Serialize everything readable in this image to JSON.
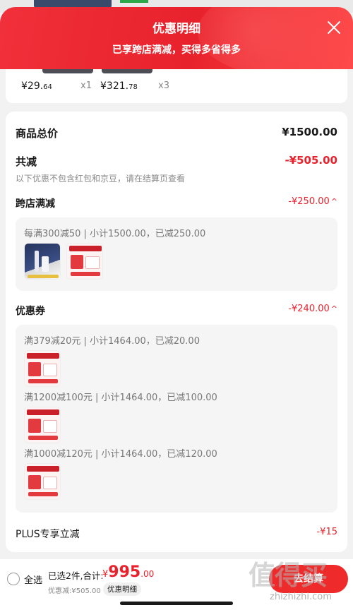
{
  "header": {
    "title": "优惠明细",
    "subtitle": "已享跨店满减，买得多省得多"
  },
  "products": [
    {
      "price_main": "¥29.",
      "price_dec": "64",
      "qty": "x1"
    },
    {
      "price_main": "¥321.",
      "price_dec": "78",
      "qty": "x3"
    }
  ],
  "summary": {
    "total_label": "商品总价",
    "total_value": "¥1500.00",
    "discount_label": "共减",
    "discount_value": "-¥505.00",
    "note": "以下优惠不包含红包和京豆，请在结算页查看"
  },
  "cross_store": {
    "label": "跨店满减",
    "value": "-¥250.00",
    "rule": "每满300减50 | 小计1500.00，已减250.00"
  },
  "coupons": {
    "label": "优惠券",
    "value": "-¥240.00",
    "items": [
      {
        "rule": "满379减20元 | 小计1464.00，已减20.00"
      },
      {
        "rule": "满1200减100元 | 小计1464.00，已减100.00"
      },
      {
        "rule": "满1000减120元 | 小计1464.00，已减120.00"
      }
    ]
  },
  "plus": {
    "label": "PLUS专享立减",
    "value": "-¥15"
  },
  "bottom": {
    "select_all": "全选",
    "selected": "已选2件,合计:",
    "currency": "¥",
    "total_int": "995",
    "total_dec": ".00",
    "saved": "优惠减:¥505.00",
    "detail": "优惠明细",
    "checkout": "去结算"
  },
  "watermark": {
    "main": "值得买",
    "url": "zhizhizhi.com"
  },
  "colors": {
    "accent": "#e8222c",
    "header_bg": "#f0303a"
  }
}
